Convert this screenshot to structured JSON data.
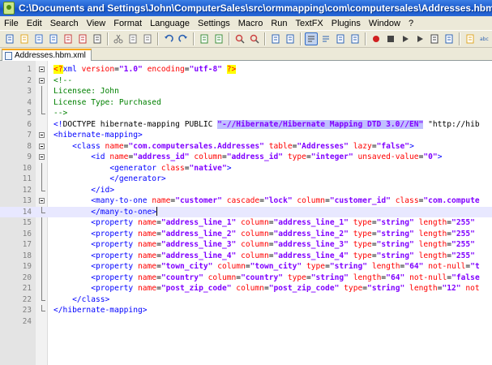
{
  "window": {
    "title": "C:\\Documents and Settings\\John\\ComputerSales\\src\\ormmapping\\com\\computersales\\Addresses.hbm.xml - Notepad++"
  },
  "menu": [
    "File",
    "Edit",
    "Search",
    "View",
    "Format",
    "Language",
    "Settings",
    "Macro",
    "Run",
    "TextFX",
    "Plugins",
    "Window",
    "?"
  ],
  "toolbar": {
    "icons": [
      "new-file-icon",
      "open-file-icon",
      "save-icon",
      "save-all-icon",
      "close-icon",
      "close-all-icon",
      "print-icon",
      "cut-icon",
      "copy-icon",
      "paste-icon",
      "undo-icon",
      "redo-icon",
      "find-icon",
      "replace-icon",
      "zoom-in-icon",
      "zoom-out-icon",
      "sync-vertical-icon",
      "sync-horizontal-icon",
      "word-wrap-icon",
      "show-all-chars-icon",
      "indent-guide-icon",
      "user-lang-icon",
      "record-macro-icon",
      "stop-macro-icon",
      "play-macro-icon",
      "play-multiple-icon",
      "save-macro-icon",
      "trim-icon",
      "folder-icon",
      "abc-spellcheck-icon"
    ]
  },
  "tab": {
    "label": "Addresses.hbm.xml"
  },
  "editor": {
    "current_line": 14,
    "lines": [
      {
        "n": "1",
        "fold": "box",
        "segs": [
          [
            "pi",
            "<?"
          ],
          [
            "t",
            "xml "
          ],
          [
            "a",
            "version"
          ],
          [
            "p",
            "="
          ],
          [
            "v",
            "\"1.0\""
          ],
          [
            "p",
            " "
          ],
          [
            "a",
            "encoding"
          ],
          [
            "p",
            "="
          ],
          [
            "v",
            "\"utf-8\""
          ],
          [
            "p",
            " "
          ],
          [
            "pi",
            "?>"
          ]
        ]
      },
      {
        "n": "2",
        "fold": "box",
        "segs": [
          [
            "c",
            "<!--"
          ]
        ]
      },
      {
        "n": "3",
        "fold": "line",
        "segs": [
          [
            "c",
            "Licensee: John"
          ]
        ]
      },
      {
        "n": "4",
        "fold": "line",
        "segs": [
          [
            "c",
            "License Type: Purchased"
          ]
        ]
      },
      {
        "n": "5",
        "fold": "end",
        "segs": [
          [
            "c",
            "-->"
          ]
        ]
      },
      {
        "n": "6",
        "fold": "",
        "segs": [
          [
            "t",
            "<!"
          ],
          [
            "p",
            "DOCTYPE hibernate-mapping PUBLIC "
          ],
          [
            "sel",
            "\"-//Hibernate/Hibernate Mapping DTD 3.0//EN\""
          ],
          [
            "p",
            " \"http://hib"
          ]
        ]
      },
      {
        "n": "7",
        "fold": "box",
        "segs": [
          [
            "t",
            "<hibernate-mapping>"
          ]
        ]
      },
      {
        "n": "8",
        "fold": "box",
        "segs": [
          [
            "p",
            "    "
          ],
          [
            "t",
            "<class "
          ],
          [
            "a",
            "name"
          ],
          [
            "p",
            "="
          ],
          [
            "v",
            "\"com.computersales.Addresses\""
          ],
          [
            "p",
            " "
          ],
          [
            "a",
            "table"
          ],
          [
            "p",
            "="
          ],
          [
            "v",
            "\"Addresses\""
          ],
          [
            "p",
            " "
          ],
          [
            "a",
            "lazy"
          ],
          [
            "p",
            "="
          ],
          [
            "v",
            "\"false\""
          ],
          [
            "t",
            ">"
          ]
        ]
      },
      {
        "n": "9",
        "fold": "box",
        "segs": [
          [
            "p",
            "        "
          ],
          [
            "t",
            "<id "
          ],
          [
            "a",
            "name"
          ],
          [
            "p",
            "="
          ],
          [
            "v",
            "\"address_id\""
          ],
          [
            "p",
            " "
          ],
          [
            "a",
            "column"
          ],
          [
            "p",
            "="
          ],
          [
            "v",
            "\"address_id\""
          ],
          [
            "p",
            " "
          ],
          [
            "a",
            "type"
          ],
          [
            "p",
            "="
          ],
          [
            "v",
            "\"integer\""
          ],
          [
            "p",
            " "
          ],
          [
            "a",
            "unsaved-value"
          ],
          [
            "p",
            "="
          ],
          [
            "v",
            "\"0\""
          ],
          [
            "t",
            ">"
          ]
        ]
      },
      {
        "n": "10",
        "fold": "line",
        "segs": [
          [
            "p",
            "            "
          ],
          [
            "t",
            "<generator "
          ],
          [
            "a",
            "class"
          ],
          [
            "p",
            "="
          ],
          [
            "v",
            "\"native\""
          ],
          [
            "t",
            ">"
          ]
        ]
      },
      {
        "n": "11",
        "fold": "line",
        "segs": [
          [
            "p",
            "            "
          ],
          [
            "t",
            "</generator>"
          ]
        ]
      },
      {
        "n": "12",
        "fold": "end",
        "segs": [
          [
            "p",
            "        "
          ],
          [
            "t",
            "</id>"
          ]
        ]
      },
      {
        "n": "13",
        "fold": "box",
        "segs": [
          [
            "p",
            "        "
          ],
          [
            "t",
            "<many-to-one "
          ],
          [
            "a",
            "name"
          ],
          [
            "p",
            "="
          ],
          [
            "v",
            "\"customer\""
          ],
          [
            "p",
            " "
          ],
          [
            "a",
            "cascade"
          ],
          [
            "p",
            "="
          ],
          [
            "v",
            "\"lock\""
          ],
          [
            "p",
            " "
          ],
          [
            "a",
            "column"
          ],
          [
            "p",
            "="
          ],
          [
            "v",
            "\"customer_id\""
          ],
          [
            "p",
            " "
          ],
          [
            "a",
            "class"
          ],
          [
            "p",
            "="
          ],
          [
            "v",
            "\"com.compute"
          ]
        ]
      },
      {
        "n": "14",
        "fold": "end",
        "segs": [
          [
            "p",
            "        "
          ],
          [
            "t",
            "</many-to-one>"
          ],
          [
            "cur",
            ""
          ]
        ]
      },
      {
        "n": "15",
        "fold": "line",
        "segs": [
          [
            "p",
            "        "
          ],
          [
            "t",
            "<property "
          ],
          [
            "a",
            "name"
          ],
          [
            "p",
            "="
          ],
          [
            "v",
            "\"address_line_1\""
          ],
          [
            "p",
            " "
          ],
          [
            "a",
            "column"
          ],
          [
            "p",
            "="
          ],
          [
            "v",
            "\"address_line_1\""
          ],
          [
            "p",
            " "
          ],
          [
            "a",
            "type"
          ],
          [
            "p",
            "="
          ],
          [
            "v",
            "\"string\""
          ],
          [
            "p",
            " "
          ],
          [
            "a",
            "length"
          ],
          [
            "p",
            "="
          ],
          [
            "v",
            "\"255\""
          ]
        ]
      },
      {
        "n": "16",
        "fold": "line",
        "segs": [
          [
            "p",
            "        "
          ],
          [
            "t",
            "<property "
          ],
          [
            "a",
            "name"
          ],
          [
            "p",
            "="
          ],
          [
            "v",
            "\"address_line_2\""
          ],
          [
            "p",
            " "
          ],
          [
            "a",
            "column"
          ],
          [
            "p",
            "="
          ],
          [
            "v",
            "\"address_line_2\""
          ],
          [
            "p",
            " "
          ],
          [
            "a",
            "type"
          ],
          [
            "p",
            "="
          ],
          [
            "v",
            "\"string\""
          ],
          [
            "p",
            " "
          ],
          [
            "a",
            "length"
          ],
          [
            "p",
            "="
          ],
          [
            "v",
            "\"255\""
          ]
        ]
      },
      {
        "n": "17",
        "fold": "line",
        "segs": [
          [
            "p",
            "        "
          ],
          [
            "t",
            "<property "
          ],
          [
            "a",
            "name"
          ],
          [
            "p",
            "="
          ],
          [
            "v",
            "\"address_line_3\""
          ],
          [
            "p",
            " "
          ],
          [
            "a",
            "column"
          ],
          [
            "p",
            "="
          ],
          [
            "v",
            "\"address_line_3\""
          ],
          [
            "p",
            " "
          ],
          [
            "a",
            "type"
          ],
          [
            "p",
            "="
          ],
          [
            "v",
            "\"string\""
          ],
          [
            "p",
            " "
          ],
          [
            "a",
            "length"
          ],
          [
            "p",
            "="
          ],
          [
            "v",
            "\"255\""
          ]
        ]
      },
      {
        "n": "18",
        "fold": "line",
        "segs": [
          [
            "p",
            "        "
          ],
          [
            "t",
            "<property "
          ],
          [
            "a",
            "name"
          ],
          [
            "p",
            "="
          ],
          [
            "v",
            "\"address_line_4\""
          ],
          [
            "p",
            " "
          ],
          [
            "a",
            "column"
          ],
          [
            "p",
            "="
          ],
          [
            "v",
            "\"address_line_4\""
          ],
          [
            "p",
            " "
          ],
          [
            "a",
            "type"
          ],
          [
            "p",
            "="
          ],
          [
            "v",
            "\"string\""
          ],
          [
            "p",
            " "
          ],
          [
            "a",
            "length"
          ],
          [
            "p",
            "="
          ],
          [
            "v",
            "\"255\""
          ]
        ]
      },
      {
        "n": "19",
        "fold": "line",
        "segs": [
          [
            "p",
            "        "
          ],
          [
            "t",
            "<property "
          ],
          [
            "a",
            "name"
          ],
          [
            "p",
            "="
          ],
          [
            "v",
            "\"town_city\""
          ],
          [
            "p",
            " "
          ],
          [
            "a",
            "column"
          ],
          [
            "p",
            "="
          ],
          [
            "v",
            "\"town_city\""
          ],
          [
            "p",
            " "
          ],
          [
            "a",
            "type"
          ],
          [
            "p",
            "="
          ],
          [
            "v",
            "\"string\""
          ],
          [
            "p",
            " "
          ],
          [
            "a",
            "length"
          ],
          [
            "p",
            "="
          ],
          [
            "v",
            "\"64\""
          ],
          [
            "p",
            " "
          ],
          [
            "a",
            "not-null"
          ],
          [
            "p",
            "="
          ],
          [
            "v",
            "\"t"
          ]
        ]
      },
      {
        "n": "20",
        "fold": "line",
        "segs": [
          [
            "p",
            "        "
          ],
          [
            "t",
            "<property "
          ],
          [
            "a",
            "name"
          ],
          [
            "p",
            "="
          ],
          [
            "v",
            "\"country\""
          ],
          [
            "p",
            " "
          ],
          [
            "a",
            "column"
          ],
          [
            "p",
            "="
          ],
          [
            "v",
            "\"country\""
          ],
          [
            "p",
            " "
          ],
          [
            "a",
            "type"
          ],
          [
            "p",
            "="
          ],
          [
            "v",
            "\"string\""
          ],
          [
            "p",
            " "
          ],
          [
            "a",
            "length"
          ],
          [
            "p",
            "="
          ],
          [
            "v",
            "\"64\""
          ],
          [
            "p",
            " "
          ],
          [
            "a",
            "not-null"
          ],
          [
            "p",
            "="
          ],
          [
            "v",
            "\"false"
          ]
        ]
      },
      {
        "n": "21",
        "fold": "line",
        "segs": [
          [
            "p",
            "        "
          ],
          [
            "t",
            "<property "
          ],
          [
            "a",
            "name"
          ],
          [
            "p",
            "="
          ],
          [
            "v",
            "\"post_zip_code\""
          ],
          [
            "p",
            " "
          ],
          [
            "a",
            "column"
          ],
          [
            "p",
            "="
          ],
          [
            "v",
            "\"post_zip_code\""
          ],
          [
            "p",
            " "
          ],
          [
            "a",
            "type"
          ],
          [
            "p",
            "="
          ],
          [
            "v",
            "\"string\""
          ],
          [
            "p",
            " "
          ],
          [
            "a",
            "length"
          ],
          [
            "p",
            "="
          ],
          [
            "v",
            "\"12\""
          ],
          [
            "p",
            " "
          ],
          [
            "a",
            "not"
          ]
        ]
      },
      {
        "n": "22",
        "fold": "end",
        "segs": [
          [
            "p",
            "    "
          ],
          [
            "t",
            "</class>"
          ]
        ]
      },
      {
        "n": "23",
        "fold": "end",
        "segs": [
          [
            "t",
            "</hibernate-mapping>"
          ]
        ]
      },
      {
        "n": "24",
        "fold": "",
        "segs": []
      }
    ]
  }
}
